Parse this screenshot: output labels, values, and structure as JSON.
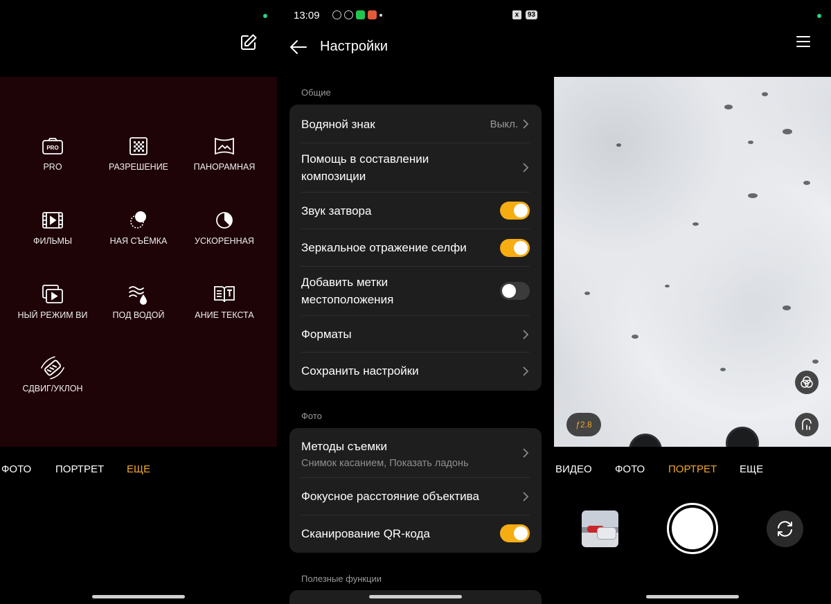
{
  "panel1": {
    "modes": [
      {
        "label": "PRO",
        "icon": "pro-camera-icon",
        "badge": "PRO"
      },
      {
        "label": "РАЗРЕШЕНИЕ",
        "icon": "high-resolution-icon"
      },
      {
        "label": "ПАНОРАМНАЯ",
        "icon": "panorama-icon"
      },
      {
        "label": "ФИЛЬМЫ",
        "icon": "film-icon"
      },
      {
        "label": "НАЯ СЪЁМКА",
        "icon": "night-mode-icon"
      },
      {
        "label": "УСКОРЕННАЯ",
        "icon": "time-lapse-icon"
      },
      {
        "label": "НЫЙ РЕЖИМ ВИ",
        "icon": "dual-video-icon"
      },
      {
        "label": "ПОД ВОДОЙ",
        "icon": "underwater-icon"
      },
      {
        "label": "АНИЕ ТЕКСТА",
        "icon": "text-scan-icon"
      },
      {
        "label": "СДВИГ/УКЛОН",
        "icon": "tilt-shift-icon"
      }
    ],
    "modebar": {
      "photo": "ФОТО",
      "portrait": "ПОРТРЕТ",
      "more": "ЕЩЕ"
    }
  },
  "panel2": {
    "status": {
      "time": "13:09",
      "battery": "93",
      "x_badge": "x"
    },
    "title": "Настройки",
    "sections": {
      "general": "Общие",
      "photo": "Фото",
      "useful": "Полезные функции"
    },
    "general": {
      "watermark": {
        "label": "Водяной знак",
        "value": "Выкл."
      },
      "composition_line1": "Помощь в составлении",
      "composition_line2": "композиции",
      "shutter_sound": {
        "label": "Звук затвора",
        "on": true
      },
      "selfie_mirror": {
        "label": "Зеркальное отражение селфи",
        "on": true
      },
      "location_line1": "Добавить метки",
      "location_line2": "местоположения",
      "location_on": false,
      "formats": "Форматы",
      "save_settings": "Сохранить настройки"
    },
    "photo": {
      "shooting_methods": "Методы съемки",
      "shooting_methods_sub": "Снимок касанием, Показать ладонь",
      "focal_length": "Фокусное расстояние объектива",
      "qr_scan": {
        "label": "Сканирование QR-кода",
        "on": true
      }
    }
  },
  "panel3": {
    "aperture": "ƒ2.8",
    "modebar": {
      "video": "ВИДЕО",
      "photo": "ФОТО",
      "portrait": "ПОРТРЕТ",
      "more": "ЕЩЕ"
    }
  },
  "colors": {
    "accent": "#f2a82a",
    "toggle_on": "#f6ad12",
    "modes_bg": "#1e0307",
    "card": "#1e1e1e"
  }
}
